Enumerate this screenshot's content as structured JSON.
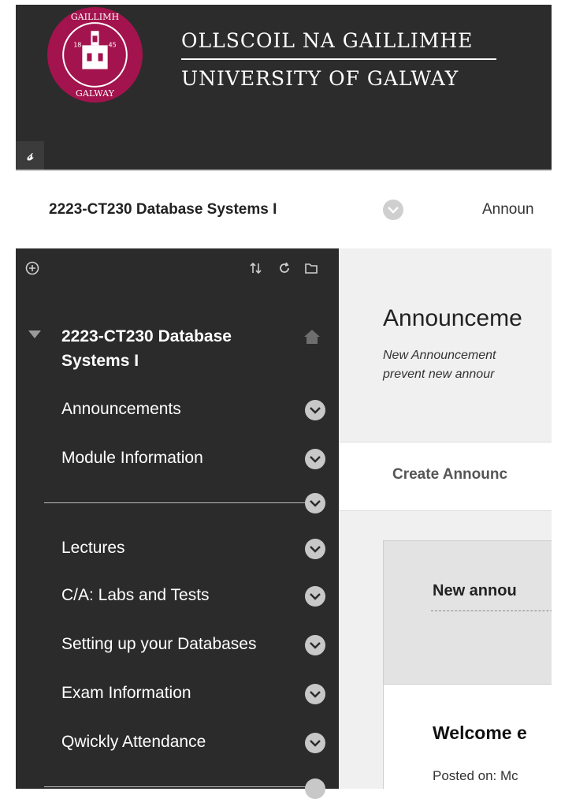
{
  "branding": {
    "irish_name": "OLLSCOIL NA GAILLIMHE",
    "english_name": "UNIVERSITY OF GALWAY",
    "seal_text_top": "GAILLIMH",
    "seal_text_bottom": "GALWAY",
    "seal_year_left": "18",
    "seal_year_right": "45",
    "color": "#a3134d"
  },
  "quick_link_glyph": "𝓈",
  "breadcrumb": {
    "course_title": "2223-CT230 Database Systems I",
    "next_label": "Announ"
  },
  "sidebar": {
    "course_title": "2223-CT230 Database Systems I",
    "items": [
      {
        "label": "Announcements"
      },
      {
        "label": "Module Information"
      },
      {
        "label": "Lectures"
      },
      {
        "label": "C/A: Labs and Tests"
      },
      {
        "label": "Setting up your Databases"
      },
      {
        "label": "Exam Information"
      },
      {
        "label": "Qwickly Attendance"
      }
    ]
  },
  "main": {
    "title": "Announceme",
    "description_line1": "New Announcement",
    "description_line2": "prevent new annour",
    "action_label": "Create Announc",
    "card1_title": "New annou",
    "card2_title": "Welcome e",
    "card2_meta": "Posted on: Mc"
  }
}
